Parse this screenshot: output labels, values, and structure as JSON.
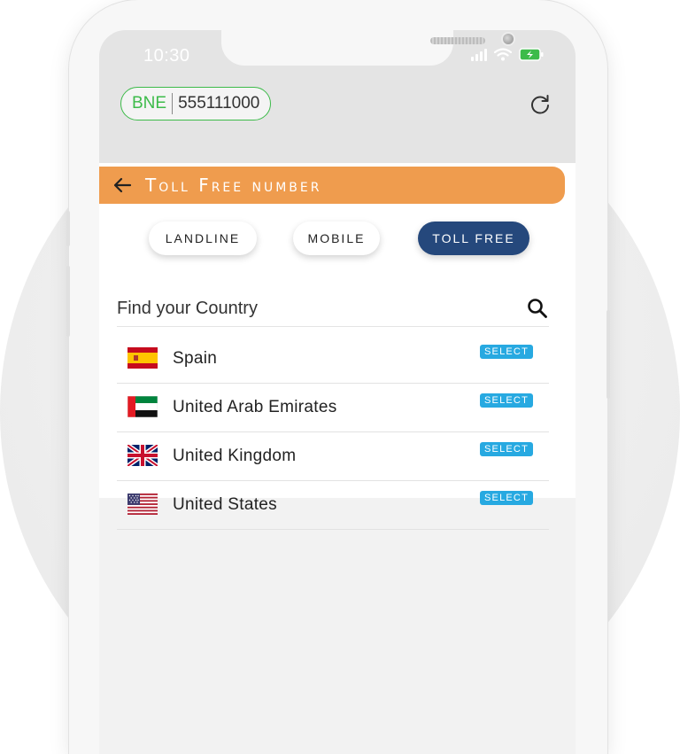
{
  "status_bar": {
    "time": "10:30"
  },
  "account": {
    "code": "BNE",
    "number": "555111000"
  },
  "header": {
    "title": "Toll Free number"
  },
  "tabs": [
    {
      "label": "LANDLINE",
      "active": false
    },
    {
      "label": "MOBILE",
      "active": false
    },
    {
      "label": "TOLL FREE",
      "active": true
    }
  ],
  "search": {
    "placeholder": "Find your Country",
    "value": ""
  },
  "countries": [
    {
      "name": "Spain",
      "flag": "spain-flag",
      "action": "SELECT"
    },
    {
      "name": "United Arab Emirates",
      "flag": "uae-flag",
      "action": "SELECT"
    },
    {
      "name": "United Kingdom",
      "flag": "uk-flag",
      "action": "SELECT"
    },
    {
      "name": "United States",
      "flag": "us-flag",
      "action": "SELECT"
    }
  ],
  "colors": {
    "header": "#ef9c4e",
    "active_tab": "#25487c",
    "account_border": "#3dbb4a",
    "select_badge": "#27a9e1"
  }
}
